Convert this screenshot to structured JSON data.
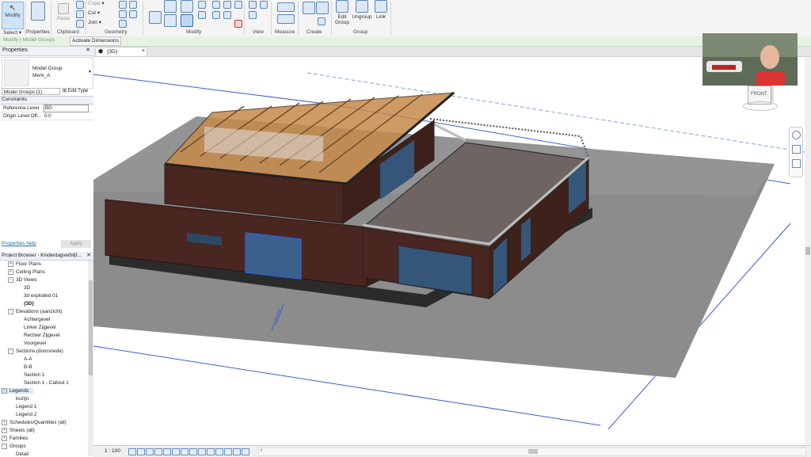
{
  "ribbon": {
    "modify_label": "Modify",
    "select_label": "Select ▾",
    "properties_label": "Properties",
    "paste_label": "Paste",
    "clipboard_label": "Clipboard",
    "cope_label": "Cope",
    "cut_label": "Cut",
    "join_label": "Join",
    "geometry_label": "Geometry",
    "modify_group_label": "Modify",
    "view_label": "View",
    "measure_label": "Measure",
    "create_label": "Create",
    "edit_group_label_1": "Edit",
    "edit_group_label_2": "Group",
    "ungroup_label": "Ungroup",
    "link_label": "Link",
    "group_label": "Group"
  },
  "context_bar": {
    "mode": "Modify | Model Groups",
    "activate_dimensions": "Activate Dimensions"
  },
  "properties": {
    "title": "Properties",
    "type_family": "Model Group",
    "type_name": "Merk_A",
    "selector": "Model Groups (1)",
    "edit_type": "Edit Type",
    "section": "Constraints",
    "rows": [
      {
        "label": "Reference Level",
        "value": "BG"
      },
      {
        "label": "Origin Level Off...",
        "value": "0.0"
      }
    ],
    "help": "Properties help",
    "apply": "Apply"
  },
  "browser": {
    "title": "Project Browser - Kinderdagverblijf...",
    "items": [
      {
        "text": "Floor Plans",
        "tw": "+"
      },
      {
        "text": "Ceiling Plans",
        "tw": "+"
      },
      {
        "text": "3D Views",
        "tw": "−"
      },
      {
        "text": "3D"
      },
      {
        "text": "3d exploded 01"
      },
      {
        "text": "{3D}"
      },
      {
        "text": "Elevations (aanzicht)",
        "tw": "−"
      },
      {
        "text": "Achtergevel"
      },
      {
        "text": "Linker Zijgevel"
      },
      {
        "text": "Rechter Zijgevel"
      },
      {
        "text": "Voorgevel"
      },
      {
        "text": "Sections (doorsnede)",
        "tw": "−"
      },
      {
        "text": "A-A"
      },
      {
        "text": "B-B"
      },
      {
        "text": "Section 1"
      },
      {
        "text": "Section 1 - Callout 1"
      },
      {
        "text": "Legends",
        "tw": "−"
      },
      {
        "text": "kozijn"
      },
      {
        "text": "Legend 1"
      },
      {
        "text": "Legend 2"
      },
      {
        "text": "Schedules/Quantities (all)",
        "tw": "+"
      },
      {
        "text": "Sheets (all)",
        "tw": "+"
      },
      {
        "text": "Families",
        "tw": "+"
      },
      {
        "text": "Groups",
        "tw": "−"
      },
      {
        "text": "Detail"
      }
    ]
  },
  "view": {
    "tab_label": "{3D}",
    "tab_close": "×",
    "viewcube_label": "FRONT",
    "scale": "1 : 100"
  },
  "colors": {
    "accent": "#1e6fc0",
    "brick": "#4a2620",
    "roof_wood": "#c78a4b",
    "ground": "#8a8a8a",
    "selection": "#2f5fd0"
  }
}
